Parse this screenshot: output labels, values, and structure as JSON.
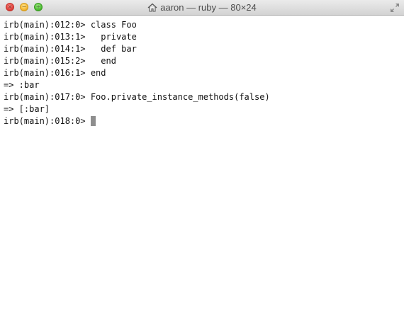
{
  "window": {
    "title": "aaron — ruby — 80×24",
    "buttons": {
      "close_glyph": "×",
      "minimize_glyph": "−",
      "zoom_glyph": "+"
    },
    "icons": {
      "title": "home-icon",
      "resize": "fullscreen-arrows-icon"
    }
  },
  "terminal": {
    "lines": [
      "irb(main):012:0> class Foo",
      "irb(main):013:1>   private",
      "irb(main):014:1>   def bar",
      "irb(main):015:2>   end",
      "irb(main):016:1> end",
      "=> :bar",
      "irb(main):017:0> Foo.private_instance_methods(false)",
      "=> [:bar]"
    ],
    "prompt": "irb(main):018:0> "
  },
  "colors": {
    "background": "#ffffff",
    "text": "#111111",
    "cursor": "#8e8e8e"
  }
}
